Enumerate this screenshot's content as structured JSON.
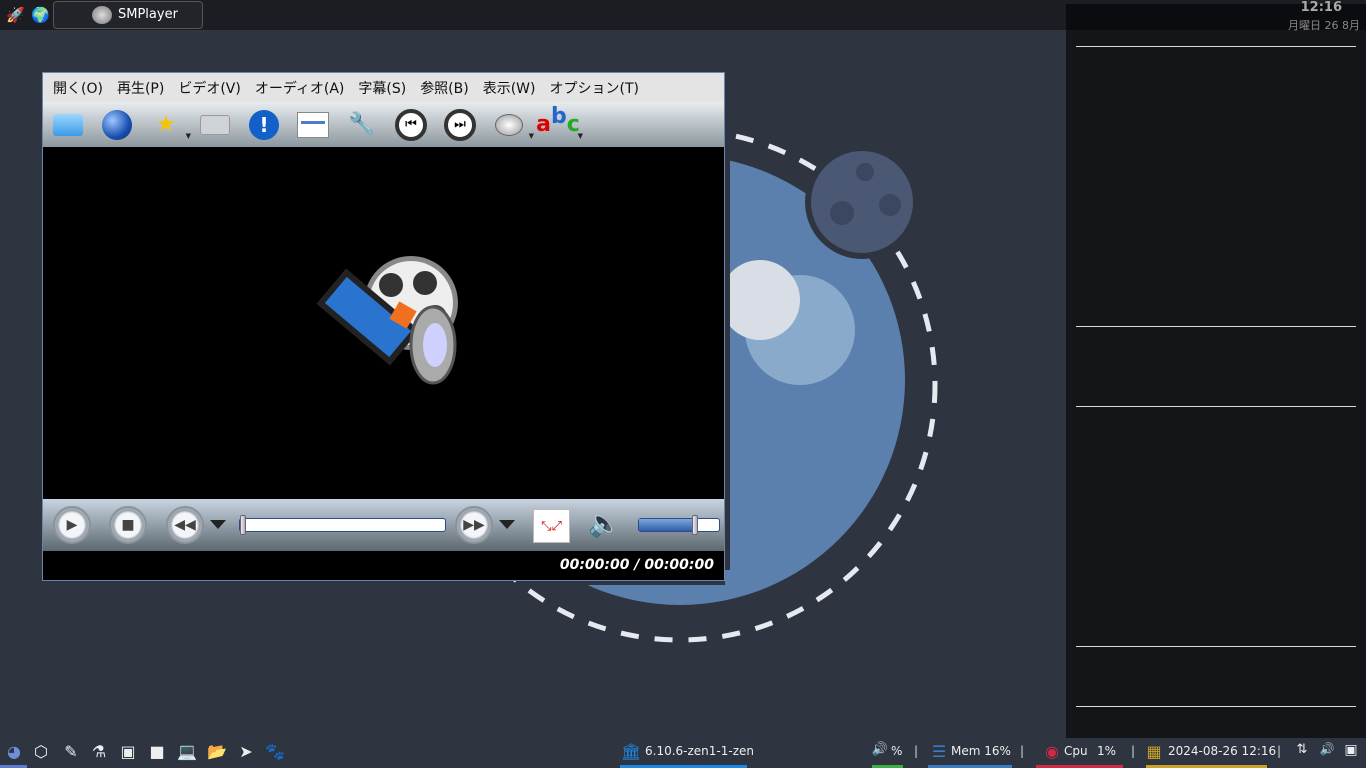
{
  "topbar": {
    "task_label": "SMPlayer"
  },
  "clock": {
    "time": "12:16",
    "date": "月曜日 26 8月"
  },
  "player": {
    "menu": [
      "開く(O)",
      "再生(P)",
      "ビデオ(V)",
      "オーディオ(A)",
      "字幕(S)",
      "参照(B)",
      "表示(W)",
      "オプション(T)"
    ],
    "time_display": "00:00:00 / 00:00:00",
    "seek_position": 0,
    "volume_percent": 70
  },
  "bottombar": {
    "kernel": "6.10.6-zen1-1-zen",
    "volume": "%",
    "mem": "Mem 16%",
    "cpu_label": "Cpu",
    "cpu_value": "1%",
    "datetime": "2024-08-26 12:16",
    "separator": "|"
  },
  "colors": {
    "kernel": "#1e88e5",
    "volume": "#3cb043",
    "mem": "#3a7cc4",
    "cpu": "#d02a45",
    "date": "#c9a227"
  }
}
